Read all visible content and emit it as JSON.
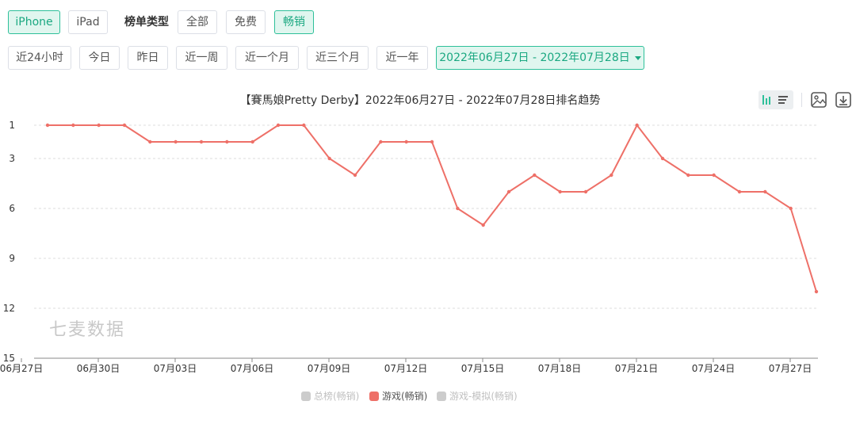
{
  "device_tabs": [
    {
      "label": "iPhone",
      "active": true
    },
    {
      "label": "iPad",
      "active": false
    }
  ],
  "rank_type": {
    "label": "榜单类型",
    "options": [
      {
        "label": "全部",
        "active": false
      },
      {
        "label": "免费",
        "active": false
      },
      {
        "label": "畅销",
        "active": true
      }
    ]
  },
  "time_ranges": [
    {
      "label": "近24小时"
    },
    {
      "label": "今日"
    },
    {
      "label": "昨日"
    },
    {
      "label": "近一周"
    },
    {
      "label": "近一个月"
    },
    {
      "label": "近三个月"
    },
    {
      "label": "近一年"
    }
  ],
  "date_range": "2022年06月27日 - 2022年07月28日",
  "watermark": "七麦数据",
  "colors": {
    "accent": "#2ec09a",
    "line": "#ee7068",
    "legend_inactive": "#cccccc"
  },
  "chart_data": {
    "type": "line",
    "title": "【賽馬娘Pretty Derby】2022年06月27日 - 2022年07月28日排名趋势",
    "y_axis": {
      "inverted": true,
      "range": [
        1,
        15
      ],
      "ticks": [
        1,
        3,
        6,
        9,
        12,
        15
      ]
    },
    "x_tick_labels": [
      "06月27日",
      "06月30日",
      "07月03日",
      "07月06日",
      "07月09日",
      "07月12日",
      "07月15日",
      "07月18日",
      "07月21日",
      "07月24日",
      "07月27日"
    ],
    "grid": "horizontal-dashed",
    "legend_position": "bottom",
    "series": [
      {
        "name": "游戏(畅销)",
        "visible": true,
        "values": [
          1,
          1,
          1,
          1,
          2,
          2,
          2,
          2,
          2,
          1,
          1,
          3,
          4,
          2,
          2,
          2,
          6,
          7,
          5,
          4,
          5,
          5,
          4,
          1,
          3,
          4,
          4,
          5,
          5,
          6,
          11
        ]
      }
    ],
    "legend": [
      {
        "name": "总榜(畅销)",
        "visible": false
      },
      {
        "name": "游戏(畅销)",
        "visible": true
      },
      {
        "name": "游戏-模拟(畅销)",
        "visible": false
      }
    ]
  }
}
